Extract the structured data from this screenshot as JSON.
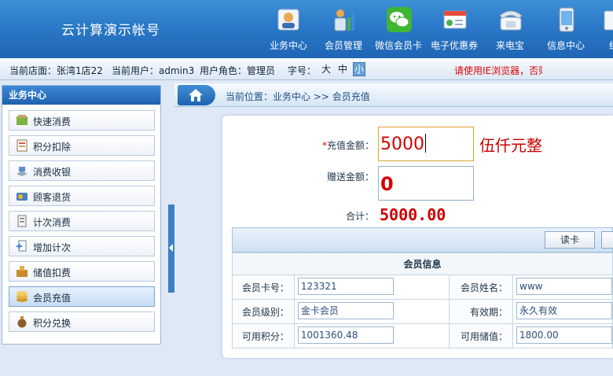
{
  "app": {
    "title": "云计算演示帐号"
  },
  "nav": {
    "items": [
      {
        "label": "业务中心",
        "icon": "user-card-icon"
      },
      {
        "label": "会员管理",
        "icon": "member-chart-icon"
      },
      {
        "label": "微信会员卡",
        "icon": "wechat-icon"
      },
      {
        "label": "电子优惠券",
        "icon": "coupon-icon"
      },
      {
        "label": "来电宝",
        "icon": "phone-icon"
      },
      {
        "label": "信息中心",
        "icon": "message-icon"
      },
      {
        "label": "统",
        "icon": "stats-icon"
      }
    ]
  },
  "infobar": {
    "store": "当前店面：张湾1店22",
    "user": "当前用户：admin3",
    "role": "用户角色：管理员",
    "font_label": "字号：",
    "font_sizes": [
      "大",
      "中",
      "小"
    ],
    "font_selected": "小",
    "notice": "请使用IE浏览器，否则"
  },
  "sidebar": {
    "title": "业务中心",
    "items": [
      {
        "label": "快速消费",
        "icon": "quick-consume-icon"
      },
      {
        "label": "积分扣除",
        "icon": "points-deduct-icon"
      },
      {
        "label": "消费收银",
        "icon": "cashier-icon"
      },
      {
        "label": "顾客退货",
        "icon": "return-goods-icon"
      },
      {
        "label": "计次消费",
        "icon": "count-consume-icon"
      },
      {
        "label": "增加计次",
        "icon": "add-count-icon"
      },
      {
        "label": "储值扣费",
        "icon": "stored-value-icon"
      },
      {
        "label": "会员充值",
        "icon": "member-recharge-icon",
        "active": true
      },
      {
        "label": "积分兑换",
        "icon": "points-exchange-icon"
      }
    ]
  },
  "breadcrumb": {
    "text": "当前位置：业务中心 >> 会员充值"
  },
  "form": {
    "recharge_label": "充值金额：",
    "recharge_required": "*",
    "recharge_value": "5000",
    "recharge_words": "伍仟元整",
    "gift_label": "赠送金额：",
    "gift_value": "0",
    "total_label": "合计：",
    "total_value": "5000.00"
  },
  "toolbar": {
    "read_card_label": "读卡"
  },
  "member_info": {
    "title": "会员信息",
    "card_no_label": "会员卡号：",
    "card_no": "123321",
    "name_label": "会员姓名：",
    "name": "www",
    "level_label": "会员级别：",
    "level": "金卡会员",
    "validity_label": "有效期：",
    "validity": "永久有效",
    "points_label": "可用积分：",
    "points": "1001360.48",
    "balance_label": "可用储值：",
    "balance": "1800.00"
  }
}
